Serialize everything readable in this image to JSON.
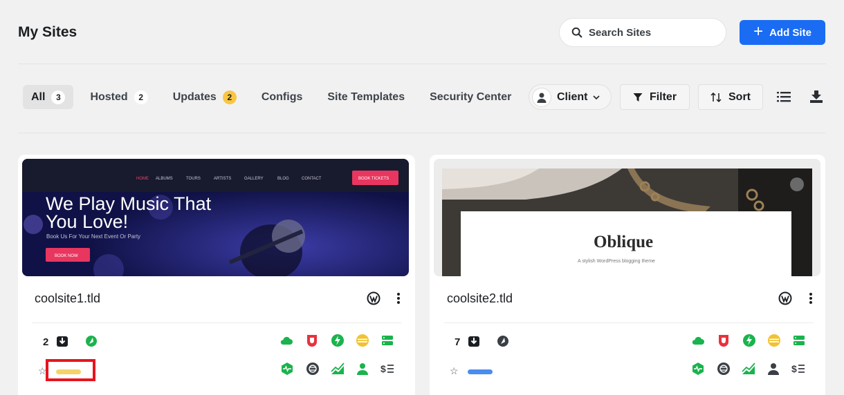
{
  "header": {
    "title": "My Sites",
    "search_placeholder": "Search Sites",
    "add_site_label": "Add Site"
  },
  "tabs": [
    {
      "label": "All",
      "count": "3",
      "active": true
    },
    {
      "label": "Hosted",
      "count": "2"
    },
    {
      "label": "Updates",
      "count": "2"
    },
    {
      "label": "Configs"
    },
    {
      "label": "Site Templates"
    },
    {
      "label": "Security Center"
    }
  ],
  "toolbar": {
    "client_label": "Client",
    "filter_label": "Filter",
    "sort_label": "Sort",
    "list_view_icon": "list-icon",
    "export_icon": "download-icon"
  },
  "sites": [
    {
      "name": "coolsite1.tld",
      "updates": "2",
      "tag_color": "#f5d36b",
      "thumb": {
        "nav": [
          "HOME",
          "ALBUMS",
          "TOURS",
          "ARTISTS",
          "GALLERY",
          "BLOG",
          "CONTACT"
        ],
        "cta": "BOOK TICKETS",
        "headline1": "We Play Music That",
        "headline2": "You Love!",
        "sub": "Book Us For Your Next Event Or Party",
        "button": "BOOK NOW"
      }
    },
    {
      "name": "coolsite2.tld",
      "updates": "7",
      "tag_color": "#4a8cf0",
      "thumb": {
        "headline": "Oblique",
        "sub": "A stylish WordPress blogging theme"
      }
    }
  ],
  "colors": {
    "accent": "#1a6cf3",
    "success": "#1ab34d",
    "danger": "#e8323c",
    "warning": "#f2c230",
    "highlight": "#e8141d"
  }
}
